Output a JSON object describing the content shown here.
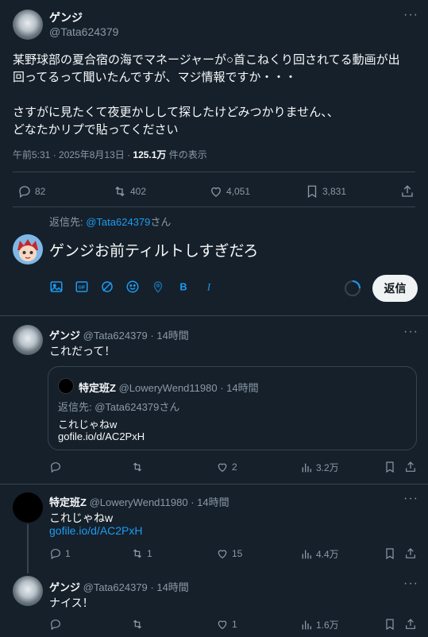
{
  "main_post": {
    "author_name": "ゲンジ",
    "author_handle": "@Tata624379",
    "text_line1": "某野球部の夏合宿の海でマネージャーが○首こねくり回されてる動画が出",
    "text_line2": "回ってるって聞いたんですが、マジ情報ですか・・・",
    "text_line3": "さすがに見たくて夜更かしして探したけどみつかりません、、",
    "text_line4": "どなたかリプで貼ってください",
    "timestamp": "午前5:31 · 2025年8月13日 · ",
    "views_count": "125.1万",
    "views_suffix": " 件の表示",
    "replies": "82",
    "reposts": "402",
    "likes": "4,051",
    "bookmarks": "3,831"
  },
  "composer": {
    "replying_to_prefix": "返信先: ",
    "replying_to_handle": "@Tata624379",
    "replying_to_suffix": "さん",
    "draft_text": "ゲンジお前ティルトしすぎだろ",
    "reply_button": "返信"
  },
  "reply1": {
    "author_name": "ゲンジ",
    "meta": "@Tata624379 · 14時間",
    "text": "これだって！",
    "quote": {
      "author_name": "特定班Z",
      "meta": "@LoweryWend11980 · 14時間",
      "replying_to": "返信先: @Tata624379さん",
      "text_line1": "これじゃねw",
      "text_line2": "gofile.io/d/AC2PxH"
    },
    "likes": "2",
    "views": "3.2万"
  },
  "reply2": {
    "author_name": "特定班Z",
    "meta": "@LoweryWend11980 · 14時間",
    "text": "これじゃねw",
    "link": "gofile.io/d/AC2PxH",
    "replies": "1",
    "reposts": "1",
    "likes": "15",
    "views": "4.4万"
  },
  "reply3": {
    "author_name": "ゲンジ",
    "meta": "@Tata624379 · 14時間",
    "text": "ナイス！",
    "likes": "1",
    "views": "1.6万"
  }
}
